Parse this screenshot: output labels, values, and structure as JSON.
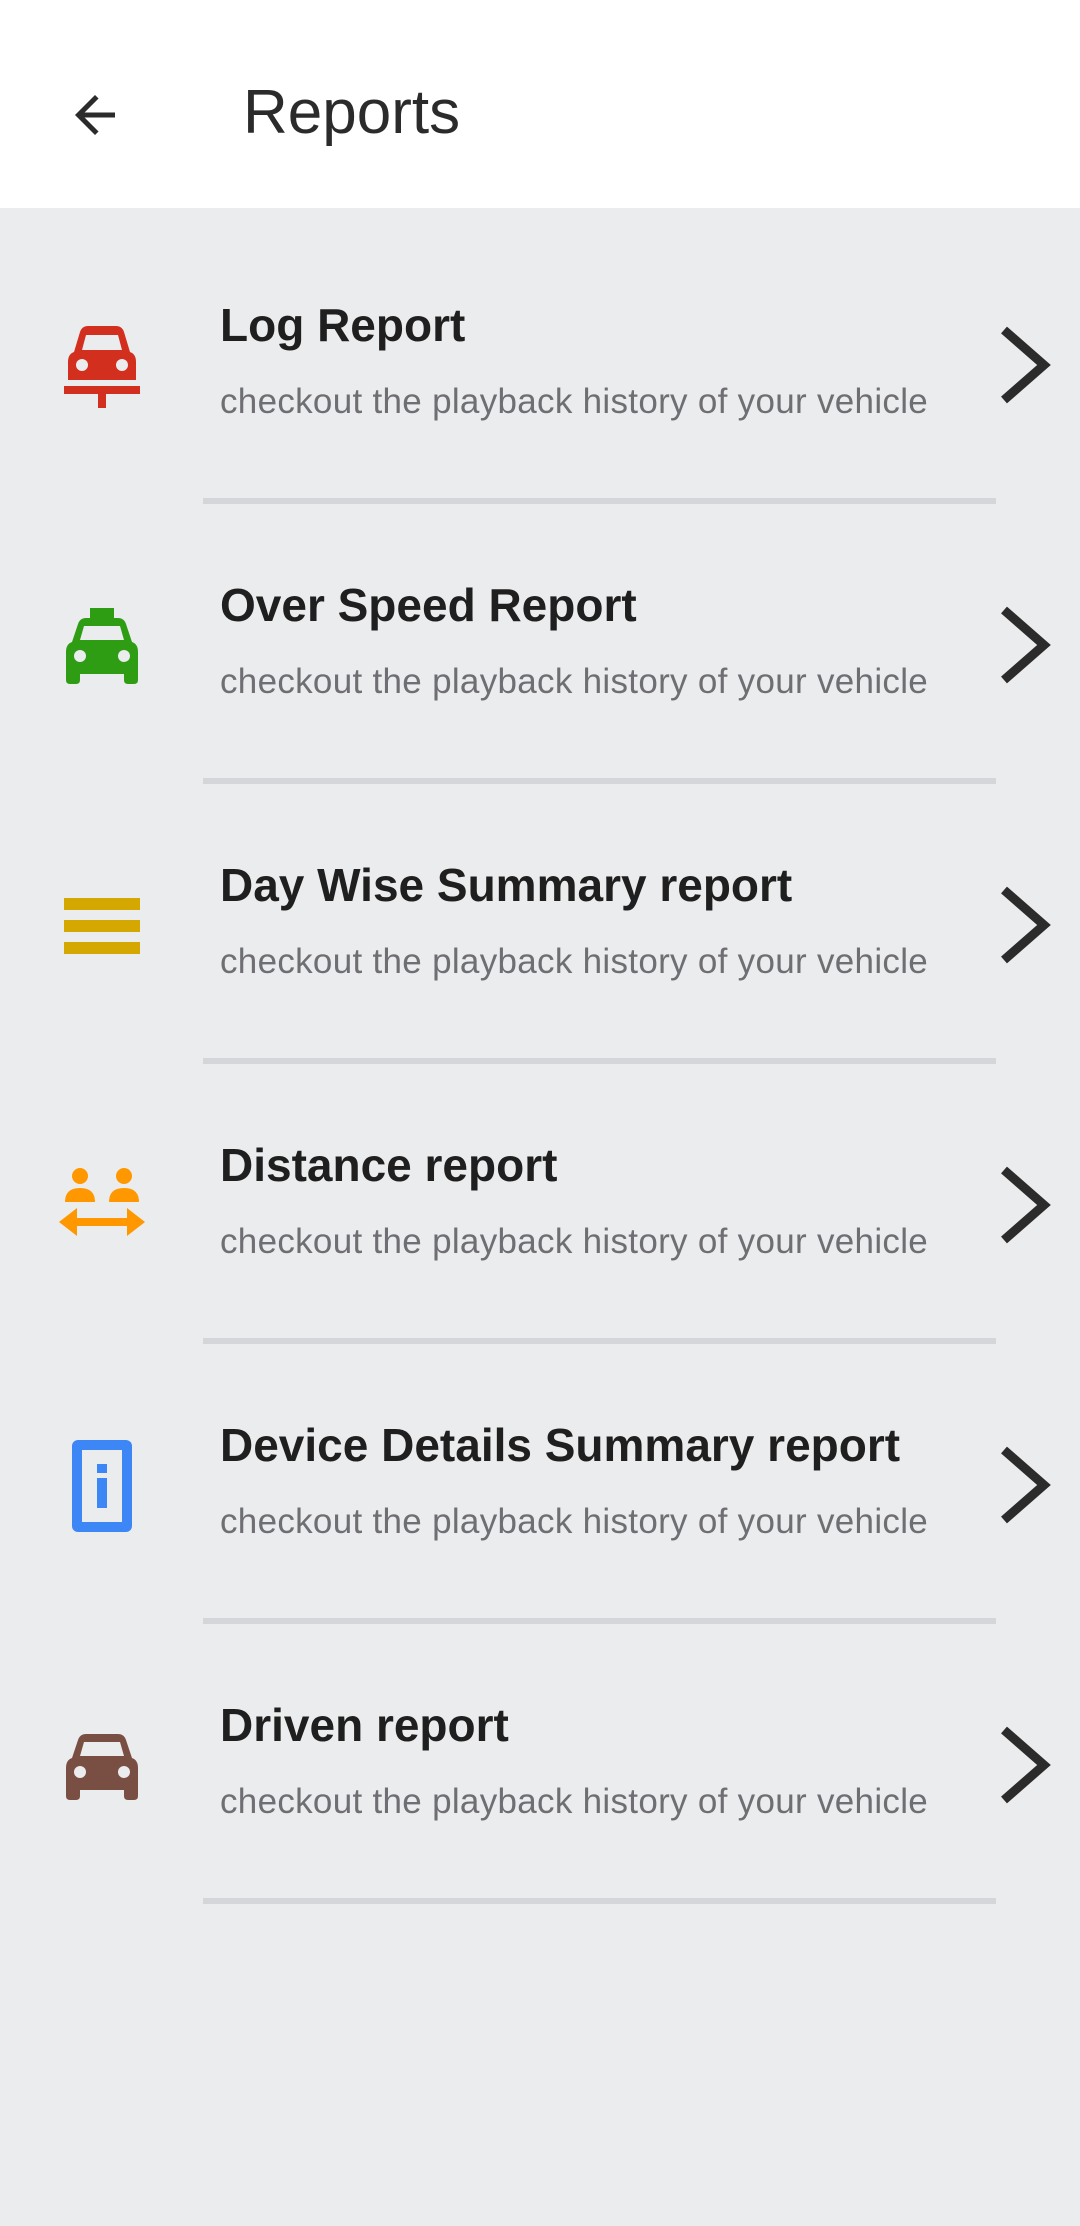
{
  "header": {
    "title": "Reports"
  },
  "items": [
    {
      "title": "Log Report",
      "subtitle": "checkout the playback history of your vehicle",
      "icon": "car-stand-icon",
      "color": "#d32f1f"
    },
    {
      "title": "Over Speed Report",
      "subtitle": "checkout the playback history of your vehicle",
      "icon": "taxi-icon",
      "color": "#2e9d14"
    },
    {
      "title": "Day Wise Summary report",
      "subtitle": "checkout the playback history of your vehicle",
      "icon": "equal-bars-icon",
      "color": "#d4a800"
    },
    {
      "title": "Distance report",
      "subtitle": "checkout the playback history of your vehicle",
      "icon": "social-distance-icon",
      "color": "#ff9800"
    },
    {
      "title": "Device Details Summary report",
      "subtitle": "checkout the playback history of your vehicle",
      "icon": "device-info-icon",
      "color": "#3d86f6"
    },
    {
      "title": "Driven report",
      "subtitle": "checkout the playback history of your vehicle",
      "icon": "car-icon",
      "color": "#7a4f43"
    }
  ]
}
